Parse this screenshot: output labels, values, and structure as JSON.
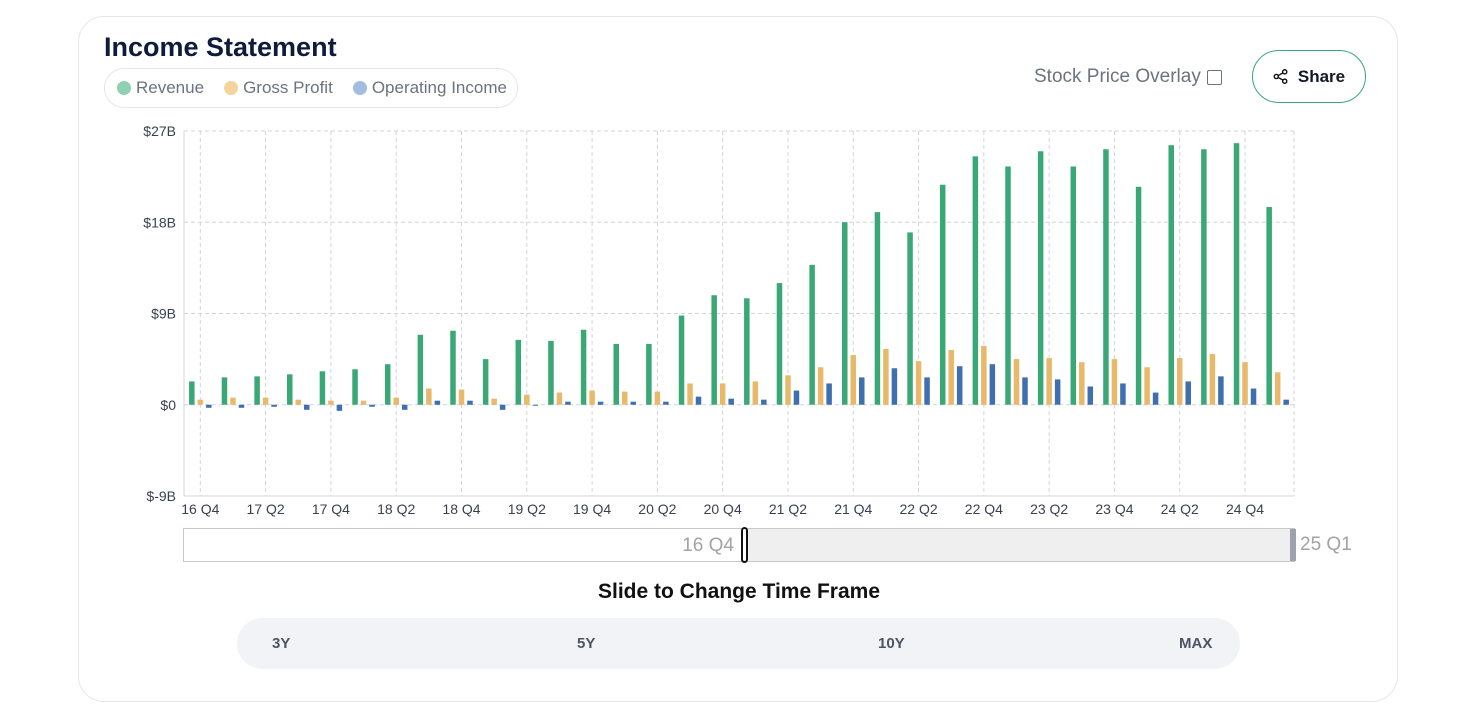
{
  "title": "Income Statement",
  "legend": [
    {
      "label": "Revenue",
      "color": "#8ed1b3"
    },
    {
      "label": "Gross Profit",
      "color": "#f4d39c"
    },
    {
      "label": "Operating Income",
      "color": "#a3bde0"
    }
  ],
  "controls": {
    "overlay_label": "Stock Price Overlay",
    "overlay_checked": false,
    "share_label": "Share",
    "share_icon": "share-icon"
  },
  "slider": {
    "start_label": "16 Q4",
    "end_label": "25 Q1",
    "caption": "Slide to Change Time Frame"
  },
  "ranges": [
    "3Y",
    "5Y",
    "10Y",
    "MAX"
  ],
  "chart_data": {
    "type": "bar",
    "y_unit": "$B",
    "ylim": [
      -9,
      27
    ],
    "y_ticks": [
      "$27B",
      "$18B",
      "$9B",
      "$0",
      "$-9B"
    ],
    "y_tick_values": [
      27,
      18,
      9,
      0,
      -9
    ],
    "grid": true,
    "periods": [
      "16 Q4",
      "17 Q1",
      "17 Q2",
      "17 Q3",
      "17 Q4",
      "18 Q1",
      "18 Q2",
      "18 Q3",
      "18 Q4",
      "19 Q1",
      "19 Q2",
      "19 Q3",
      "19 Q4",
      "20 Q1",
      "20 Q2",
      "20 Q3",
      "20 Q4",
      "21 Q1",
      "21 Q2",
      "21 Q3",
      "21 Q4",
      "22 Q1",
      "22 Q2",
      "22 Q3",
      "22 Q4",
      "23 Q1",
      "23 Q2",
      "23 Q3",
      "23 Q4",
      "24 Q1",
      "24 Q2",
      "24 Q3",
      "24 Q4",
      "25 Q1"
    ],
    "x_tick_labels": [
      "16 Q4",
      "17 Q2",
      "17 Q4",
      "18 Q2",
      "18 Q4",
      "19 Q2",
      "19 Q4",
      "20 Q2",
      "20 Q4",
      "21 Q2",
      "21 Q4",
      "22 Q2",
      "22 Q4",
      "23 Q2",
      "23 Q4",
      "24 Q2",
      "24 Q4"
    ],
    "series": [
      {
        "name": "Revenue",
        "color": "#3aa876",
        "values": [
          2.3,
          2.7,
          2.8,
          3.0,
          3.3,
          3.5,
          4.0,
          6.9,
          7.3,
          4.5,
          6.4,
          6.3,
          7.4,
          6.0,
          6.0,
          8.8,
          10.8,
          10.5,
          12.0,
          13.8,
          18.0,
          19.0,
          17.0,
          21.7,
          24.5,
          23.5,
          25.0,
          23.5,
          25.2,
          21.5,
          25.6,
          25.2,
          25.8,
          19.5
        ]
      },
      {
        "name": "Gross Profit",
        "color": "#e8b86b",
        "values": [
          0.5,
          0.7,
          0.7,
          0.5,
          0.4,
          0.4,
          0.7,
          1.6,
          1.5,
          0.6,
          1.0,
          1.2,
          1.4,
          1.3,
          1.3,
          2.1,
          2.1,
          2.3,
          2.9,
          3.7,
          4.9,
          5.5,
          4.3,
          5.4,
          5.8,
          4.5,
          4.6,
          4.2,
          4.5,
          3.7,
          4.6,
          5.0,
          4.2,
          3.2
        ]
      },
      {
        "name": "Operating Income",
        "color": "#3f6fae",
        "values": [
          -0.3,
          -0.3,
          -0.2,
          -0.5,
          -0.6,
          -0.2,
          -0.5,
          0.4,
          0.4,
          -0.5,
          0.0,
          0.3,
          0.3,
          0.3,
          0.3,
          0.8,
          0.6,
          0.5,
          1.4,
          2.1,
          2.7,
          3.6,
          2.7,
          3.8,
          4.0,
          2.7,
          2.5,
          1.8,
          2.1,
          1.2,
          2.3,
          2.8,
          1.6,
          0.5
        ]
      }
    ]
  }
}
